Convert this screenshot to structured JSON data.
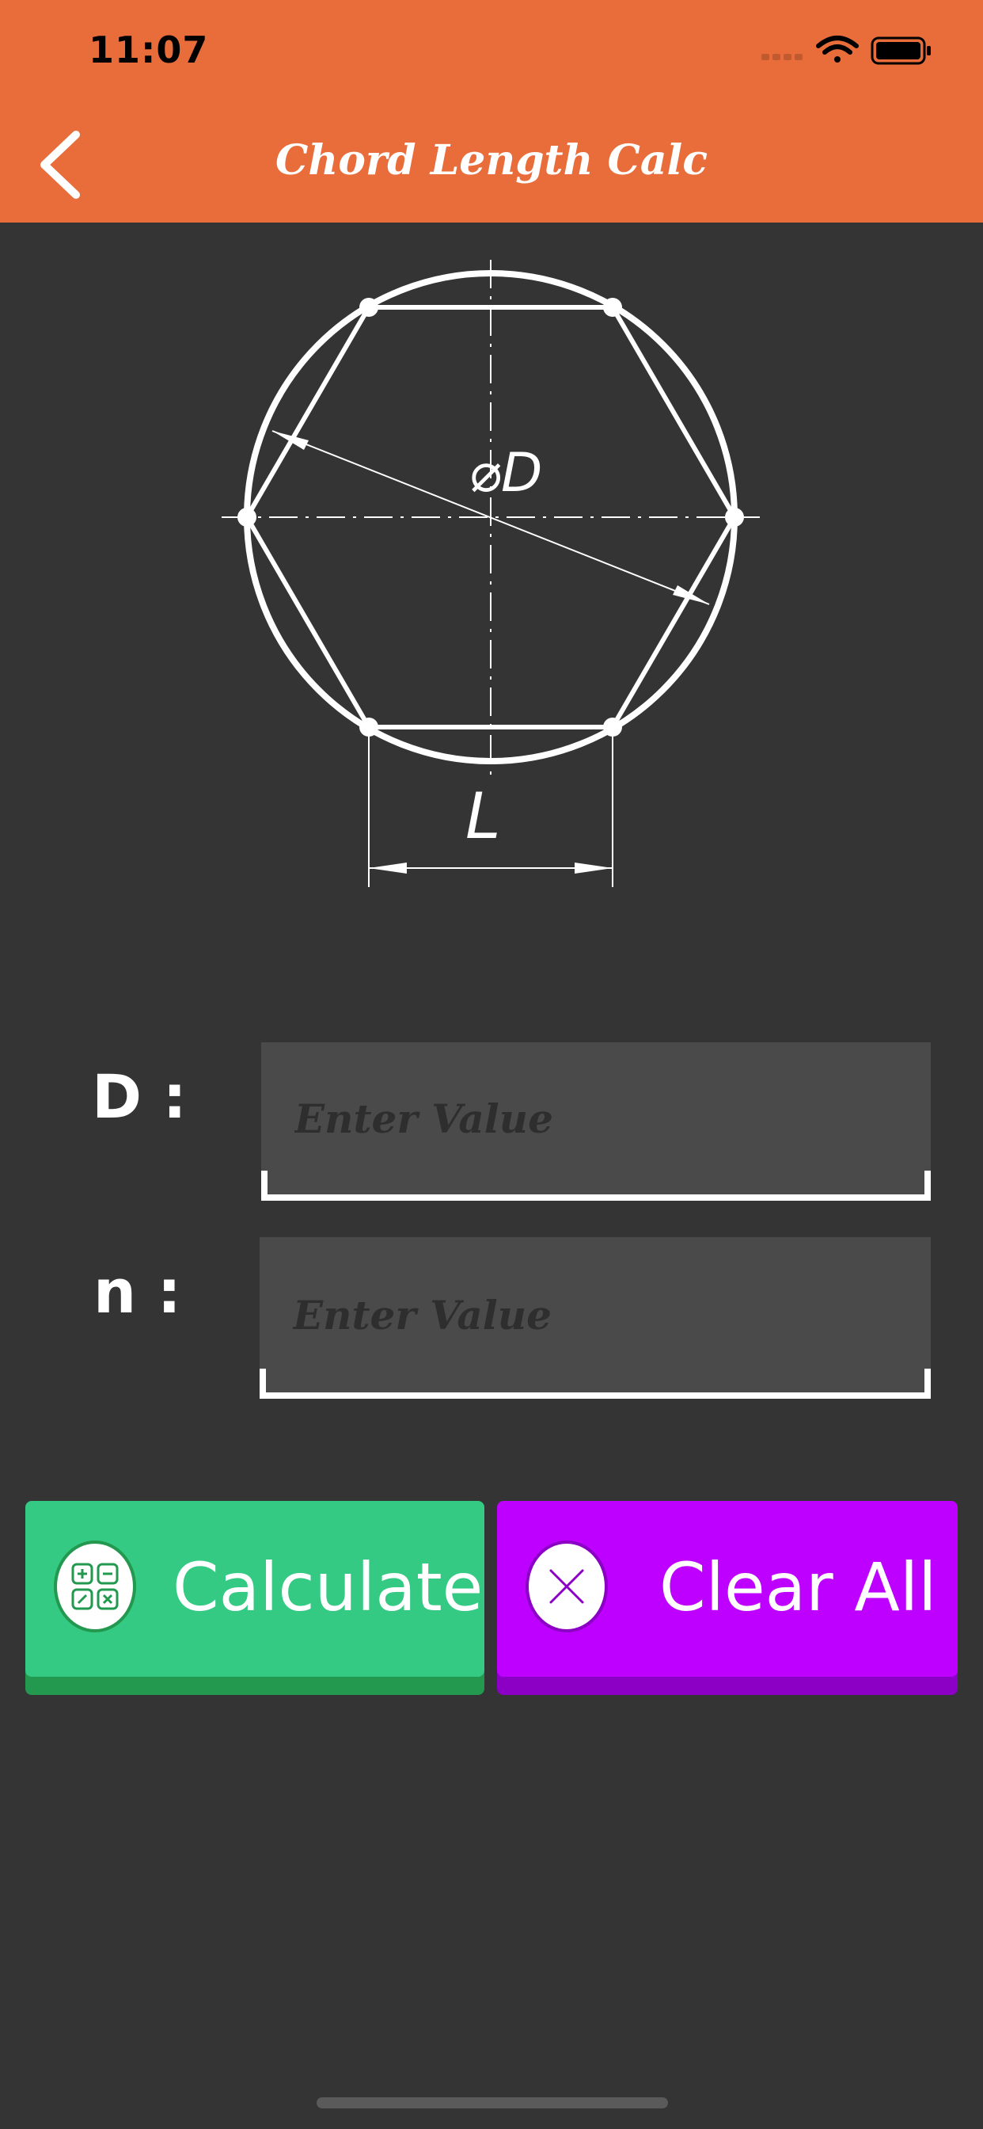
{
  "status_bar": {
    "time": "11:07"
  },
  "nav": {
    "title": "Chord Length Calc",
    "back_icon": "chevron-left-icon"
  },
  "diagram": {
    "diameter_label": "⌀D",
    "chord_label": "L"
  },
  "form": {
    "d_field": {
      "label": "D :",
      "placeholder": "Enter Value",
      "value": ""
    },
    "n_field": {
      "label": "n :",
      "placeholder": "Enter Value",
      "value": ""
    }
  },
  "buttons": {
    "calculate": {
      "label": "Calculate",
      "icon": "calculator-icon"
    },
    "clear": {
      "label": "Clear All",
      "icon": "close-circle-icon"
    }
  },
  "colors": {
    "header": "#E96D3A",
    "background": "#343434",
    "calculate": "#35CA83",
    "clear": "#BD00FF"
  }
}
